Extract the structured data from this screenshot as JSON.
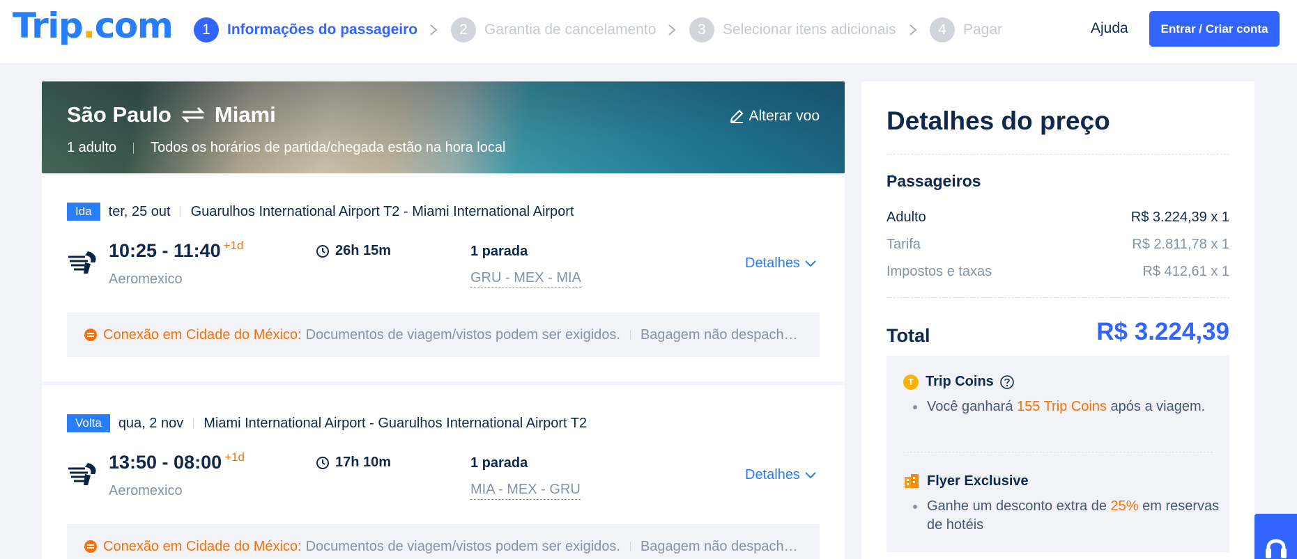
{
  "header": {
    "logo_main": "Trip",
    "logo_dot": ".",
    "logo_tld": "com",
    "steps": [
      {
        "num": "1",
        "label": "Informações do passageiro"
      },
      {
        "num": "2",
        "label": "Garantia de cancelamento"
      },
      {
        "num": "3",
        "label": "Selecionar itens adicionais"
      },
      {
        "num": "4",
        "label": "Pagar"
      }
    ],
    "help": "Ajuda",
    "login_button": "Entrar / Criar conta"
  },
  "hero": {
    "origin": "São Paulo",
    "destination": "Miami",
    "passengers": "1 adulto",
    "timezone_note": "Todos os horários de partida/chegada estão na hora local",
    "change_flight": "Alterar voo"
  },
  "flights": [
    {
      "badge": "Ida",
      "date": "ter, 25 out",
      "route": "Guarulhos International Airport T2 - Miami International Airport",
      "times": "10:25 - 11:40",
      "day_offset": "+1d",
      "airline": "Aeromexico",
      "duration": "26h 15m",
      "stops": "1 parada",
      "codes": "GRU - MEX - MIA",
      "details": "Detalhes",
      "notice_title": "Conexão em Cidade do México:",
      "notice_text": "Documentos de viagem/vistos podem ser exigidos.",
      "notice_extra": "Bagagem não despachada automaticamente"
    },
    {
      "badge": "Volta",
      "date": "qua, 2 nov",
      "route": "Miami International Airport - Guarulhos International Airport T2",
      "times": "13:50 - 08:00",
      "day_offset": "+1d",
      "airline": "Aeromexico",
      "duration": "17h 10m",
      "stops": "1 parada",
      "codes": "MIA - MEX - GRU",
      "details": "Detalhes",
      "notice_title": "Conexão em Cidade do México:",
      "notice_text": "Documentos de viagem/vistos podem ser exigidos.",
      "notice_extra": "Bagagem não despachada automaticamente"
    }
  ],
  "price": {
    "title": "Detalhes do preço",
    "passengers_label": "Passageiros",
    "rows": [
      {
        "label": "Adulto",
        "value": "R$ 3.224,39 x 1"
      },
      {
        "label": "Tarifa",
        "value": "R$ 2.811,78 x 1"
      },
      {
        "label": "Impostos e taxas",
        "value": "R$ 412,61 x 1"
      }
    ],
    "total_label": "Total",
    "total_value": "R$ 3.224,39",
    "trip_coins_title": "Trip Coins",
    "trip_coins_pre": "Você ganhará",
    "trip_coins_highlight": "155 Trip Coins",
    "trip_coins_post": "após a viagem.",
    "flyer_title": "Flyer Exclusive",
    "flyer_pre": "Ganhe um desconto extra de",
    "flyer_highlight": "25%",
    "flyer_post": "em reservas de hotéis"
  },
  "colors": {
    "brand_blue": "#287dfa",
    "primary_button": "#3264ff",
    "accent_orange": "#ff6f00",
    "coin_yellow": "#ffb000",
    "text_dark": "#0f294d"
  }
}
